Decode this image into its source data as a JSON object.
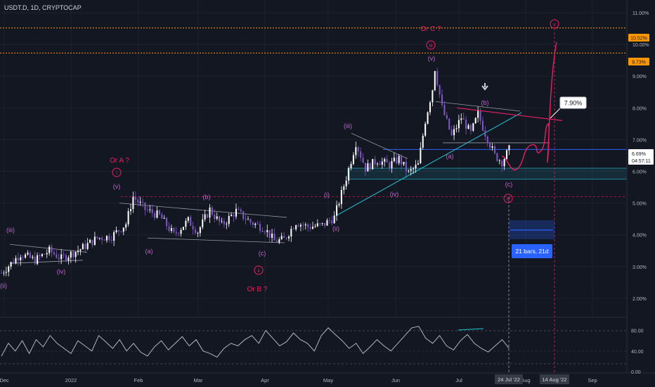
{
  "symbol_title": "USDT.D, 1D, CRYPTOCAP",
  "colors": {
    "background": "#131722",
    "grid": "#1e222d",
    "candle_up": "#ffffff",
    "candle_down": "#7e57c2",
    "wave_label": "#ba68c8",
    "circle_label": "#e91e63",
    "annotation": "#e91e63",
    "orange_level": "#ff9800",
    "cyan_line": "#26c6da",
    "blue_line": "#2962ff",
    "rsi": "#b2b5be",
    "axis_text": "#b2b5be",
    "current_price_box": "#ffffff"
  },
  "chart_data": [
    {
      "type": "candlestick",
      "title": "USDT.D, 1D, CRYPTOCAP",
      "x_tick_labels": [
        "Dec",
        "2022",
        "Feb",
        "Mar",
        "Apr",
        "May",
        "Jun",
        "Jul",
        "Aug",
        "Sep"
      ],
      "y_tick_labels": [
        "2.00%",
        "3.00%",
        "4.00%",
        "5.00%",
        "6.00%",
        "7.00%",
        "8.00%",
        "9.00%",
        "10.00%",
        "11.00%"
      ],
      "ylim": [
        1.4,
        11.4
      ],
      "close_path": [
        [
          0,
          2.8
        ],
        [
          8,
          3.4
        ],
        [
          14,
          3.2
        ],
        [
          20,
          3.5
        ],
        [
          25,
          3.25
        ],
        [
          33,
          3.55
        ],
        [
          40,
          3.9
        ],
        [
          46,
          3.95
        ],
        [
          52,
          4.35
        ],
        [
          55,
          5.2
        ],
        [
          60,
          4.8
        ],
        [
          66,
          4.6
        ],
        [
          72,
          4.0
        ],
        [
          78,
          4.45
        ],
        [
          82,
          4.1
        ],
        [
          87,
          4.8
        ],
        [
          92,
          4.3
        ],
        [
          98,
          4.75
        ],
        [
          104,
          4.4
        ],
        [
          110,
          4.2
        ],
        [
          114,
          3.8
        ],
        [
          118,
          3.85
        ],
        [
          123,
          4.4
        ],
        [
          128,
          4.25
        ],
        [
          134,
          4.3
        ],
        [
          139,
          4.55
        ],
        [
          144,
          5.8
        ],
        [
          148,
          6.9
        ],
        [
          152,
          6.1
        ],
        [
          157,
          6.35
        ],
        [
          162,
          6.2
        ],
        [
          166,
          6.4
        ],
        [
          170,
          5.95
        ],
        [
          174,
          6.2
        ],
        [
          177,
          7.6
        ],
        [
          180,
          8.6
        ],
        [
          181,
          9.25
        ],
        [
          184,
          8.0
        ],
        [
          188,
          7.1
        ],
        [
          192,
          7.7
        ],
        [
          196,
          7.2
        ],
        [
          199,
          7.8
        ],
        [
          202,
          7.2
        ],
        [
          206,
          6.5
        ],
        [
          209,
          6.3
        ],
        [
          212,
          6.69
        ]
      ],
      "rsi": {
        "y_tick_labels": [
          "80.00",
          "40.00",
          "0.00"
        ],
        "ylim": [
          0,
          100
        ],
        "values": [
          30,
          55,
          40,
          60,
          35,
          62,
          48,
          70,
          55,
          45,
          35,
          60,
          50,
          40,
          70,
          58,
          45,
          62,
          40,
          55,
          38,
          30,
          48,
          60,
          42,
          55,
          68,
          50,
          62,
          40,
          35,
          28,
          45,
          55,
          50,
          62,
          70,
          55,
          80,
          65,
          50,
          58,
          75,
          62,
          55,
          40,
          70,
          85,
          72,
          60,
          45,
          55,
          35,
          48,
          62,
          50,
          40,
          55,
          70,
          85,
          88,
          65,
          55,
          70,
          50,
          42,
          60,
          72,
          55,
          45,
          38,
          50,
          62,
          45
        ]
      },
      "levels": [
        {
          "label": "10.52%",
          "value": 10.52,
          "color": "#ff9800"
        },
        {
          "label": "9.73%",
          "value": 9.73,
          "color": "#ff9800"
        }
      ],
      "current_price": {
        "label": "6.69%",
        "countdown": "04:57:11",
        "value": 6.69
      },
      "date_markers": [
        "24 Jul '22",
        "14 Aug '22"
      ],
      "annotations": {
        "or_c": "Or C ?",
        "or_a": "Or A ?",
        "or_b": "Or B ?",
        "target_price": "7.90%",
        "bars_range": "21 bars, 21d",
        "circle_iii": "iii",
        "circle_i": "i",
        "circle_ii": "ii",
        "circle_iv": "iv",
        "circle_v": "v",
        "w_v_top": "(v)",
        "w_v_a": "(v)",
        "w_iii_left": "(iii)",
        "w_ii_left": "(ii)",
        "w_iv_left": "(iv)",
        "w_a1": "(a)",
        "w_b1": "(b)",
        "w_c1": "(c)",
        "w_i2": "(i)",
        "w_ii2": "(ii)",
        "w_iii2": "(iii)",
        "w_iv2": "(iv)",
        "w_a2": "(a)",
        "w_b2": "(b)",
        "w_c2": "(c)"
      }
    }
  ]
}
